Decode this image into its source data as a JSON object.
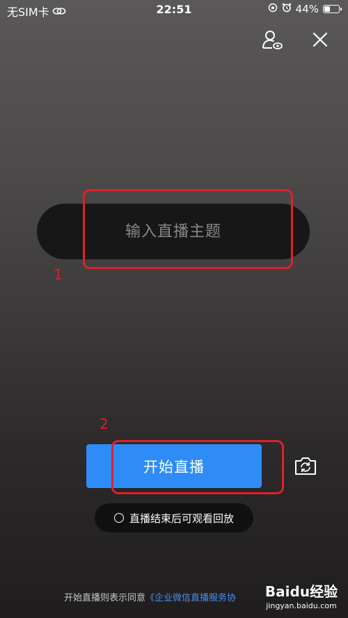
{
  "status_bar": {
    "carrier": "无SIM卡",
    "time": "22:51",
    "battery": "44%",
    "battery_level": 0.44
  },
  "top_bar": {
    "profile_icon": "user-settings-icon",
    "close_icon": "close-icon"
  },
  "title_input": {
    "placeholder": "输入直播主题",
    "value": ""
  },
  "annotations": {
    "label_1": "1",
    "label_2": "2",
    "color": "#e0202a"
  },
  "start_button": {
    "label": "开始直播",
    "color": "#2f8cf6"
  },
  "camera_switch": {
    "icon": "camera-switch-icon"
  },
  "replay_option": {
    "label": "直播结束后可观看回放",
    "checked": false
  },
  "agreement": {
    "prefix": "开始直播则表示同意",
    "link": "《企业微信直播服务协"
  },
  "watermark": {
    "main": "Baidu经验",
    "sub": "jingyan.baidu.com"
  }
}
